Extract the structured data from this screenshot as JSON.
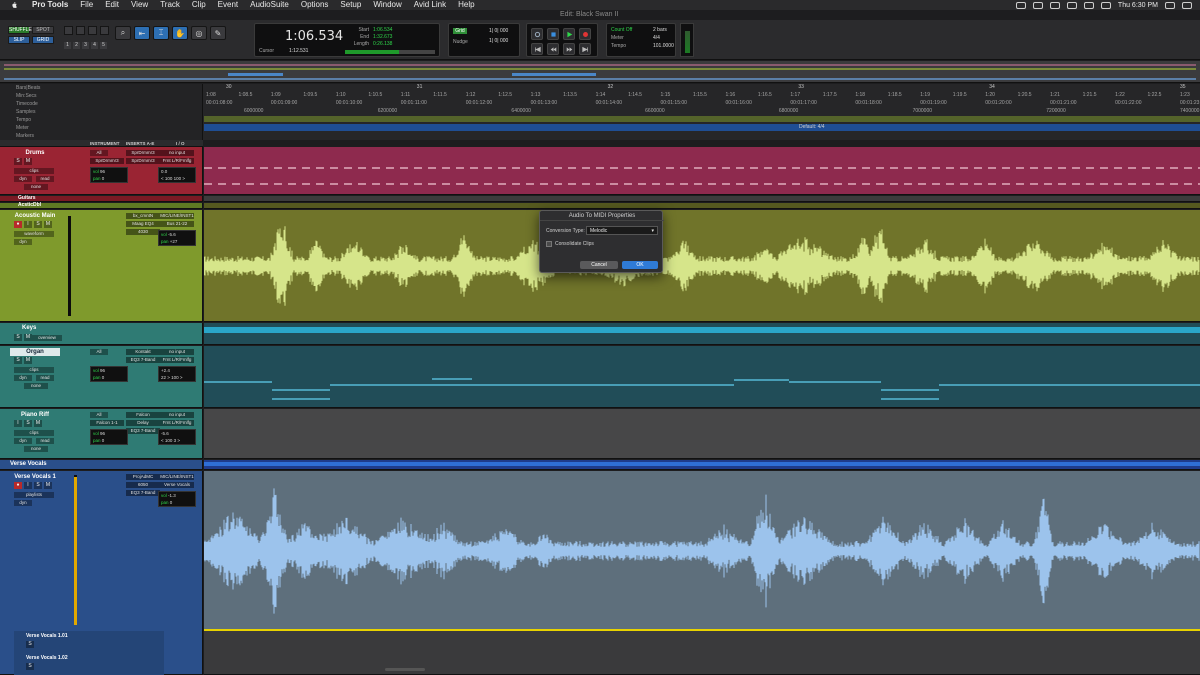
{
  "menubar": {
    "app": "Pro Tools",
    "items": [
      "File",
      "Edit",
      "View",
      "Track",
      "Clip",
      "Event",
      "AudioSuite",
      "Options",
      "Setup",
      "Window",
      "Avid Link",
      "Help"
    ],
    "clock": "Thu 6:30 PM"
  },
  "window_title": "Edit: Black Swan II",
  "toolbar": {
    "modes": [
      "SHUFFLE",
      "SPOT",
      "SLIP",
      "GRID"
    ],
    "zoom_presets": [
      "1",
      "2",
      "3",
      "4",
      "5"
    ],
    "main_counter": "1:06.534",
    "cursor_label": "Cursor",
    "cursor_value": "1:12.531",
    "sel_labels": [
      "Start",
      "End",
      "Length"
    ],
    "sel_values": [
      "1:06.534",
      "1:32.673",
      "0:26.138"
    ],
    "grid_label": "Grid",
    "grid_value": "1| 0| 000",
    "nudge_label": "Nudge",
    "nudge_value": "1| 0| 000",
    "count_off": "Count Off",
    "count_off_val": "2 bars",
    "meter_label": "Meter",
    "meter_val": "4/4",
    "tempo_label": "Tempo",
    "tempo_val": "101.0000",
    "level_right": "80"
  },
  "rulers": {
    "labels": [
      "Bars|Beats",
      "Min:Secs",
      "Timecode",
      "Samples",
      "Tempo",
      "Meter",
      "Markers"
    ],
    "bars": [
      "30",
      "31",
      "32",
      "33",
      "34",
      "35"
    ],
    "minsecs": [
      "1:08",
      "1:08.5",
      "1:09",
      "1:09.5",
      "1:10",
      "1:10.5",
      "1:11",
      "1:11.5",
      "1:12",
      "1:12.5",
      "1:13",
      "1:13.5",
      "1:14",
      "1:14.5",
      "1:15",
      "1:15.5",
      "1:16",
      "1:16.5",
      "1:17",
      "1:17.5",
      "1:18",
      "1:18.5",
      "1:19",
      "1:19.5",
      "1:20",
      "1:20.5",
      "1:21",
      "1:21.5",
      "1:22",
      "1:22.5",
      "1:23"
    ],
    "timecode": [
      "00:01:08:00",
      "00:01:09:00",
      "00:01:10:00",
      "00:01:11:00",
      "00:01:12:00",
      "00:01:13:00",
      "00:01:14:00",
      "00:01:15:00",
      "00:01:16:00",
      "00:01:17:00",
      "00:01:18:00",
      "00:01:19:00",
      "00:01:20:00",
      "00:01:21:00",
      "00:01:22:00",
      "00:01:23:00"
    ],
    "samples": [
      "6000000",
      "6200000",
      "6400000",
      "6600000",
      "6800000",
      "7000000",
      "7200000",
      "7400000"
    ],
    "meter_text": "Default: 4/4"
  },
  "columns": [
    "INSTRUMENT",
    "INSERTS A-E",
    "I / O"
  ],
  "tracks": {
    "drums": {
      "name": "Drums",
      "view": "clips",
      "dyn": "dyn",
      "auto": "read",
      "group": "none",
      "inst": [
        "All",
        "M"
      ],
      "inst_name": "SprDrmmr3",
      "insert1": "SprDrmmr3",
      "insert2": "SprDrmmr3",
      "io_in": "no input",
      "io_out": "Frnt L/R/Fmlfg",
      "vol": "vol",
      "vol_val": "96",
      "pan": "pan",
      "pan_val": "0",
      "out_vol": "0.0",
      "out_pan": "< 100   100 >"
    },
    "guitars": {
      "name": "Guitars"
    },
    "acsticdbl": {
      "name": "AcsticDbl"
    },
    "acoustic_main": {
      "name": "Acoustic Main",
      "view": "waveform",
      "dyn": "dyn",
      "insert1": "bx_cmntN",
      "insert2": "Maag EQ4",
      "insert3": "4030",
      "io_in": "MIC/LINE/INST1",
      "io_out": "Bus 21-22",
      "vol": "vol",
      "vol_val": "-5.6",
      "pan": "pan",
      "pan_val": "+27"
    },
    "keys": {
      "name": "Keys",
      "view": "overview"
    },
    "organ": {
      "name": "Organ",
      "view": "clips",
      "dyn": "dyn",
      "auto": "read",
      "group": "none",
      "inst": [
        "All",
        "M"
      ],
      "insert1": "Kontakt",
      "insert2": "EQ3 7-Band",
      "io_in": "no input",
      "io_out": "Frnt L/R/Fmlfg",
      "vol": "vol",
      "vol_val": "96",
      "pan": "pan",
      "pan_val": "0",
      "out_vol": "+2.4",
      "out_pan": "22 >   100 >"
    },
    "piano_riff": {
      "name": "Piano Riff",
      "view": "clips",
      "dyn": "dyn",
      "auto": "read",
      "group": "none",
      "inst": [
        "All",
        "M"
      ],
      "insert1": "Falcon",
      "insert2": "Delay",
      "insert3": "EQ3 7-Band",
      "inst_name": "Falcon 1-1",
      "io_in": "no input",
      "io_out": "Frnt L/R/Fmlfg",
      "vol": "vol",
      "vol_val": "96",
      "pan": "pan",
      "pan_val": "0",
      "out_vol": "-5.6",
      "out_pan": "< 100   3 >"
    },
    "verse_vocals": {
      "name": "Verse Vocals"
    },
    "verse_vocals_1": {
      "name": "Verse Vocals 1",
      "view": "playlists",
      "dyn": "dyn",
      "insert1": "ProjAdMC",
      "insert2": "6050",
      "insert3": "EQ3 7-Band",
      "io_in": "MIC/LINE/INST1",
      "io_out": "Verse Vocals",
      "vol": "vol",
      "vol_val": "-1.3",
      "pan": "pan",
      "pan_val": "0"
    },
    "playlist_1": "Verse Vocals 1.01",
    "playlist_2": "Verse Vocals 1.02"
  },
  "dialog": {
    "title": "Audio To MIDI Properties",
    "conversion_label": "Conversion Type:",
    "conversion_value": "Melodic",
    "consolidate_label": "Consolidate Clips",
    "cancel": "Cancel",
    "ok": "OK"
  },
  "colors": {
    "drums": "#8e2a4e",
    "drums_head": "#9a2433",
    "guitar": "#70742a",
    "guitar_head": "#7f9a2c",
    "keys": "#214d58",
    "keys_head": "#2f7b74",
    "vocals": "#5e6f7c",
    "vocals_head": "#2a4f8a",
    "waveform_guitar": "#d6e58a",
    "waveform_vocal": "#9cc3ec"
  }
}
